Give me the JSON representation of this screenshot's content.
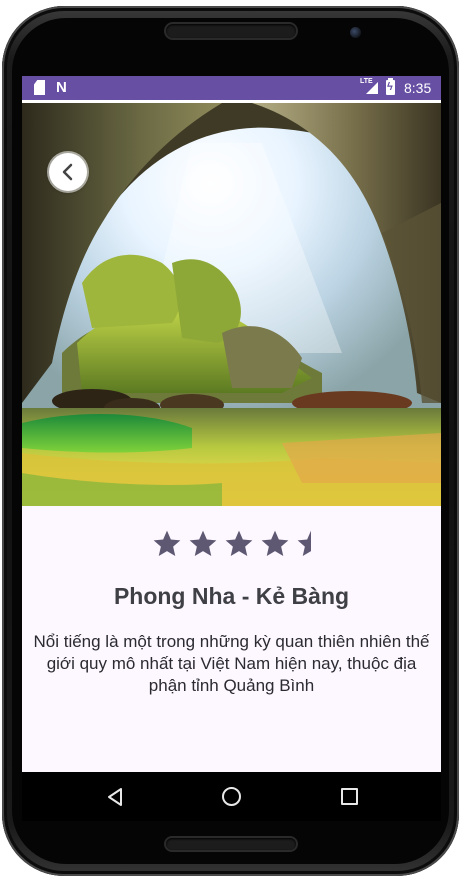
{
  "status_bar": {
    "time": "8:35",
    "network_label": "LTE",
    "left_icons": [
      "sd-card-icon",
      "n-notification-icon"
    ],
    "right_icons": [
      "lte-signal-icon",
      "battery-charging-icon"
    ],
    "color": "#6750a4"
  },
  "place": {
    "rating": 4.5,
    "rating_max": 5,
    "name": "Phong Nha - Kẻ Bàng",
    "description": "Nổi tiếng là một trong những kỳ quan thiên nhiên thế giới quy mô nhất tại Việt Nam hiện nay, thuộc địa phận tỉnh Quảng Bình"
  },
  "toolbar": {
    "back_icon": "chevron-left-icon"
  },
  "nav_bar": {
    "icons": [
      "back-triangle-icon",
      "home-circle-icon",
      "recents-square-icon"
    ]
  },
  "colors": {
    "star": "#5e5873",
    "background": "#fdf7ff",
    "title": "#3f3f46"
  }
}
